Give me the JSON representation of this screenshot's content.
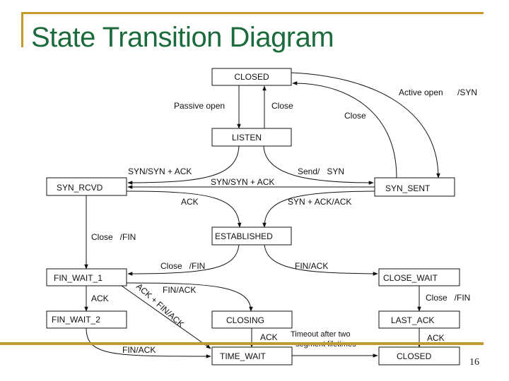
{
  "slide": {
    "title": "State Transition Diagram",
    "page_number": "16",
    "colors": {
      "title": "#1b6b3c",
      "rule": "#c49a2c"
    }
  },
  "states": {
    "closed_top": "CLOSED",
    "listen": "LISTEN",
    "syn_rcvd": "SYN_RCVD",
    "syn_sent": "SYN_SENT",
    "established": "ESTABLISHED",
    "fin_wait_1": "FIN_WAIT_1",
    "fin_wait_2": "FIN_WAIT_2",
    "closing": "CLOSING",
    "time_wait": "TIME_WAIT",
    "close_wait": "CLOSE_WAIT",
    "last_ack": "LAST_ACK",
    "closed_bottom": "CLOSED"
  },
  "transitions": {
    "passive_open": "Passive open",
    "close_listen": "Close",
    "active_open": "Active open",
    "active_open_syn": "/SYN",
    "close_syn_sent": "Close",
    "listen_syn_synack": "SYN/SYN + ACK",
    "send_syn": "Send/   SYN",
    "synsent_syn_synack": "SYN/SYN + ACK",
    "ack_rcvd": "ACK",
    "syn_ack_ack": "SYN + ACK/ACK",
    "close_fin_rcvd": "Close   /FIN",
    "close_fin_est": "Close   /FIN",
    "fin_ack_est": "FIN/ACK",
    "ack_fw1": "ACK",
    "fin_ack_fw1": "FIN/ACK",
    "ack_fin_ack": "ACK + FIN/ACK",
    "close_fin_cw": "Close   /FIN",
    "ack_closing": "ACK",
    "timeout_line1": "Timeout after two",
    "timeout_line2": "segment lifetimes",
    "ack_last": "ACK",
    "fin_ack_fw2": "FIN/ACK"
  }
}
